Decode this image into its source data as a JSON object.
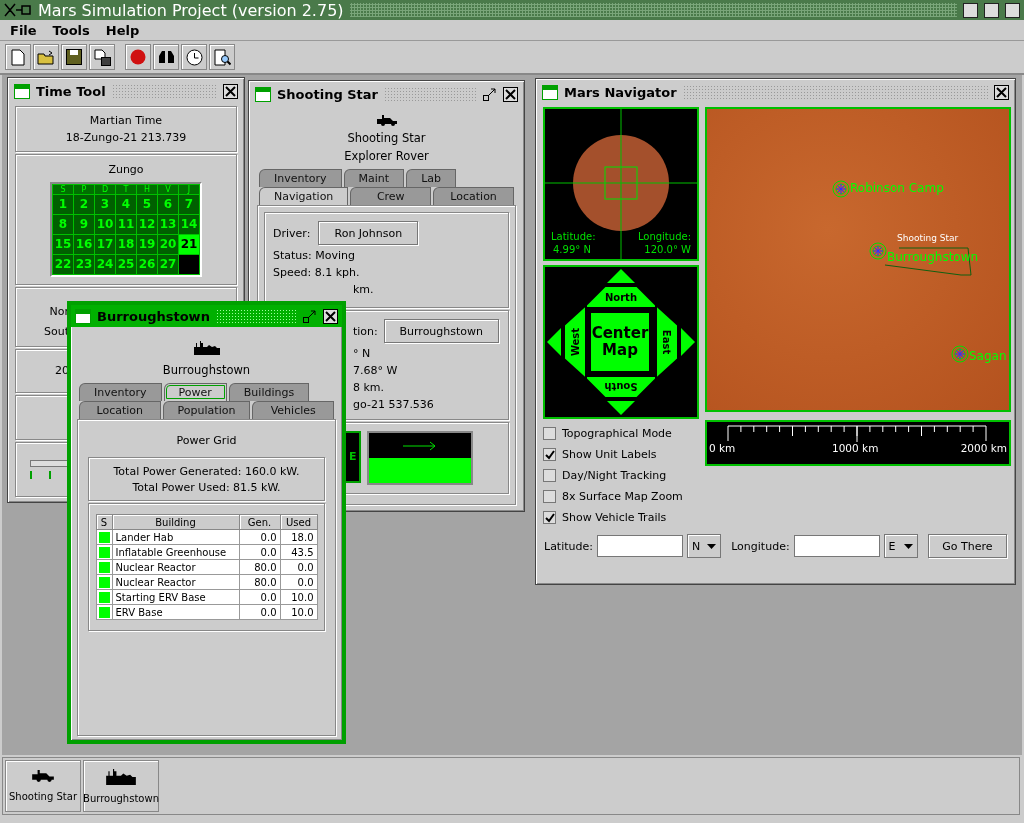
{
  "window": {
    "title": "Mars Simulation Project (version 2.75)"
  },
  "menu": [
    "File",
    "Tools",
    "Help"
  ],
  "time_tool": {
    "title": "Time Tool",
    "martian_time_label": "Martian Time",
    "martian_time": "18-Zungo-21  213.739",
    "calendar": {
      "month": "Zungo",
      "weekdays": [
        "S",
        "P",
        "D",
        "T",
        "H",
        "V",
        "J"
      ],
      "days": [
        {
          "day": "1",
          "selected": false
        },
        {
          "day": "2",
          "selected": false
        },
        {
          "day": "3",
          "selected": false
        },
        {
          "day": "4",
          "selected": false
        },
        {
          "day": "5",
          "selected": false
        },
        {
          "day": "6",
          "selected": false
        },
        {
          "day": "7",
          "selected": false
        },
        {
          "day": "8",
          "selected": false
        },
        {
          "day": "9",
          "selected": false
        },
        {
          "day": "10",
          "selected": false
        },
        {
          "day": "11",
          "selected": false
        },
        {
          "day": "12",
          "selected": false
        },
        {
          "day": "13",
          "selected": false
        },
        {
          "day": "14",
          "selected": false
        },
        {
          "day": "15",
          "selected": false
        },
        {
          "day": "16",
          "selected": false
        },
        {
          "day": "17",
          "selected": false
        },
        {
          "day": "18",
          "selected": false
        },
        {
          "day": "19",
          "selected": false
        },
        {
          "day": "20",
          "selected": false
        },
        {
          "day": "21",
          "selected": true
        },
        {
          "day": "22",
          "selected": false
        },
        {
          "day": "23",
          "selected": false
        },
        {
          "day": "24",
          "selected": false
        },
        {
          "day": "25",
          "selected": false
        },
        {
          "day": "26",
          "selected": false
        },
        {
          "day": "27",
          "selected": false
        }
      ]
    },
    "seasons": [
      "Nor",
      "Sout"
    ],
    "earth_time": "20"
  },
  "shooting_star": {
    "title": "Shooting Star",
    "name": "Shooting Star",
    "type": "Explorer Rover",
    "tab_rows": [
      [
        {
          "label": "Inventory",
          "selected": false
        },
        {
          "label": "Maint",
          "selected": false
        },
        {
          "label": "Lab",
          "selected": false
        }
      ],
      [
        {
          "label": "Navigation",
          "selected": true
        },
        {
          "label": "Crew",
          "selected": false
        },
        {
          "label": "Location",
          "selected": false
        }
      ]
    ],
    "driver_label": "Driver:",
    "driver": "Ron Johnson",
    "status": "Status: Moving",
    "speed": "Speed: 8.1 kph.",
    "elevation": "km.",
    "destination_label": "tion:",
    "destination": "Burroughstown",
    "position_lines": [
      "° N",
      "7.68° W",
      "8 km.",
      "go-21  537.536"
    ],
    "compass": "E"
  },
  "burroughstown": {
    "title": "Burroughstown",
    "name": "Burroughstown",
    "tab_rows": [
      [
        {
          "label": "Inventory",
          "selected": false
        },
        {
          "label": "Power",
          "selected": true
        },
        {
          "label": "Buildings",
          "selected": false
        }
      ],
      [
        {
          "label": "Location",
          "selected": false
        },
        {
          "label": "Population",
          "selected": false
        },
        {
          "label": "Vehicles",
          "selected": false
        }
      ]
    ],
    "panel_title": "Power Grid",
    "power_generated": "Total Power Generated: 160.0 kW.",
    "power_used": "Total Power Used: 81.5 kW.",
    "table": {
      "columns": [
        "S",
        "Building",
        "Gen.",
        "Used"
      ],
      "rows": [
        {
          "color": "#00ff00",
          "building": "Lander Hab",
          "gen": "0.0",
          "used": "18.0"
        },
        {
          "color": "#00ff00",
          "building": "Inflatable Greenhouse",
          "gen": "0.0",
          "used": "43.5"
        },
        {
          "color": "#00ff00",
          "building": "Nuclear Reactor",
          "gen": "80.0",
          "used": "0.0"
        },
        {
          "color": "#00ff00",
          "building": "Nuclear Reactor",
          "gen": "80.0",
          "used": "0.0"
        },
        {
          "color": "#00ff00",
          "building": "Starting ERV Base",
          "gen": "0.0",
          "used": "10.0"
        },
        {
          "color": "#00ff00",
          "building": "ERV Base",
          "gen": "0.0",
          "used": "10.0"
        }
      ]
    }
  },
  "navigator": {
    "title": "Mars Navigator",
    "latitude_label": "Latitude:",
    "latitude": "4.99° N",
    "longitude_label": "Longitude:",
    "longitude": "120.0° W",
    "pad": {
      "north": "North",
      "south": "South",
      "west": "West",
      "east": "East",
      "center": "Center Map"
    },
    "map_units": [
      {
        "label": "Robinson Camp",
        "kind": "settlement"
      },
      {
        "label": "Shooting Star",
        "kind": "vehicle"
      },
      {
        "label": "Burroughstown",
        "kind": "settlement"
      },
      {
        "label": "Sagan",
        "kind": "settlement"
      }
    ],
    "scale_labels": [
      "0 km",
      "1000 km",
      "2000 km"
    ],
    "options": [
      {
        "label": "Topographical Mode",
        "checked": false
      },
      {
        "label": "Show Unit Labels",
        "checked": true
      },
      {
        "label": "Day/Night Tracking",
        "checked": false
      },
      {
        "label": "8x Surface Map Zoom",
        "checked": false
      },
      {
        "label": "Show Vehicle Trails",
        "checked": true
      }
    ],
    "lat_field_label": "Latitude:",
    "lat_dir": "N",
    "lon_field_label": "Longitude:",
    "lon_dir": "E",
    "go_button": "Go There"
  },
  "taskbar": [
    {
      "label": "Shooting Star",
      "kind": "vehicle"
    },
    {
      "label": "Burroughstown",
      "kind": "settlement"
    }
  ]
}
